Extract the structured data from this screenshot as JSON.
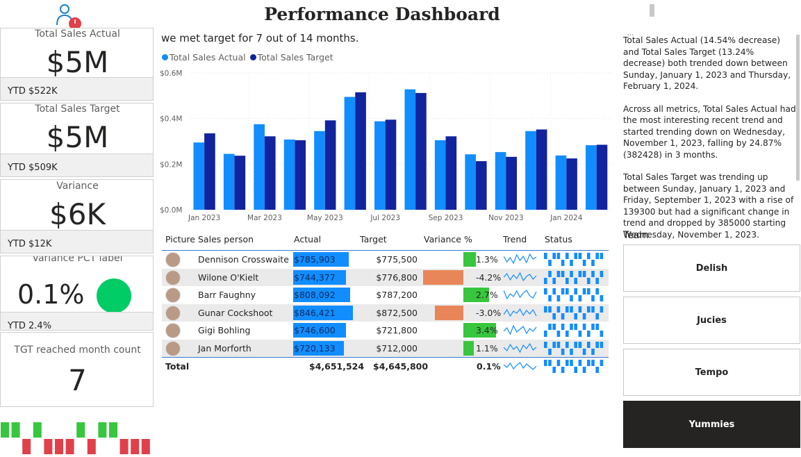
{
  "title": "Performance Dashboard",
  "kpis": {
    "sales_actual": {
      "title": "Total Sales Actual",
      "value": "$5M",
      "ytd": "YTD $522K"
    },
    "sales_target": {
      "title": "Total Sales Target",
      "value": "$5M",
      "ytd": "YTD $509K"
    },
    "variance": {
      "title": "Variance",
      "value": "$6K",
      "ytd": "YTD $12K"
    },
    "variance_pct": {
      "title": "Variance PCT label",
      "value": "0.1%",
      "ytd": "YTD 2.4%",
      "indicator_color": "#00cc66"
    },
    "tgt_reached": {
      "title": "TGT reached month count",
      "value": "7"
    }
  },
  "win_loss": [
    1,
    1,
    -1,
    1,
    -1,
    -1,
    -1,
    1,
    -1,
    1,
    1,
    -1,
    -1,
    -1
  ],
  "chart": {
    "subtitle": "we met target for 7 out of 14 months.",
    "legend": [
      "Total Sales Actual",
      "Total Sales Target"
    ]
  },
  "chart_data": {
    "type": "bar",
    "categories": [
      "Jan 2023",
      "Feb 2023",
      "Mar 2023",
      "Apr 2023",
      "May 2023",
      "Jun 2023",
      "Jul 2023",
      "Aug 2023",
      "Sep 2023",
      "Oct 2023",
      "Nov 2023",
      "Dec 2023",
      "Jan 2024",
      "Feb 2024"
    ],
    "x_tick_labels": [
      "Jan 2023",
      "Mar 2023",
      "May 2023",
      "Jul 2023",
      "Sep 2023",
      "Nov 2023",
      "Jan 2024"
    ],
    "series": [
      {
        "name": "Total Sales Actual",
        "color": "#118dff",
        "values": [
          0.295,
          0.245,
          0.375,
          0.308,
          0.345,
          0.495,
          0.388,
          0.528,
          0.305,
          0.243,
          0.253,
          0.345,
          0.238,
          0.283
        ]
      },
      {
        "name": "Total Sales Target",
        "color": "#12239e",
        "values": [
          0.335,
          0.237,
          0.322,
          0.305,
          0.392,
          0.515,
          0.395,
          0.512,
          0.322,
          0.213,
          0.232,
          0.352,
          0.225,
          0.285
        ]
      }
    ],
    "ylim": [
      0,
      0.6
    ],
    "y_ticks": [
      {
        "v": 0,
        "label": "$0.0M"
      },
      {
        "v": 0.2,
        "label": "$0.2M"
      },
      {
        "v": 0.4,
        "label": "$0.4M"
      },
      {
        "v": 0.6,
        "label": "$0.6M"
      }
    ],
    "grid": true,
    "legend_position": "top-left"
  },
  "table": {
    "headers": [
      "Picture",
      "Sales person",
      "Actual",
      "Target",
      "Variance %",
      "Trend",
      "Status"
    ],
    "max_actual": 846421,
    "rows": [
      {
        "name": "Dennison Crosswaite",
        "actual": "$785,903",
        "actual_num": 785903,
        "target": "$775,500",
        "variance": "1.3%",
        "variance_num": 1.3
      },
      {
        "name": "Wilone O'Kielt",
        "actual": "$744,377",
        "actual_num": 744377,
        "target": "$776,800",
        "variance": "-4.2%",
        "variance_num": -4.2
      },
      {
        "name": "Barr Faughny",
        "actual": "$808,092",
        "actual_num": 808092,
        "target": "$787,200",
        "variance": "2.7%",
        "variance_num": 2.7
      },
      {
        "name": "Gunar Cockshoot",
        "actual": "$846,421",
        "actual_num": 846421,
        "target": "$872,500",
        "variance": "-3.0%",
        "variance_num": -3.0
      },
      {
        "name": "Gigi Bohling",
        "actual": "$746,600",
        "actual_num": 746600,
        "target": "$721,800",
        "variance": "3.4%",
        "variance_num": 3.4
      },
      {
        "name": "Jan Morforth",
        "actual": "$720,133",
        "actual_num": 720133,
        "target": "$712,000",
        "variance": "1.1%",
        "variance_num": 1.1
      }
    ],
    "total": {
      "label": "Total",
      "actual": "$4,651,524",
      "target": "$4,645,800",
      "variance": "0.1%"
    }
  },
  "narrative": [
    "Total Sales Actual (14.54% decrease) and Total Sales Target (13.24% decrease) both trended down between Sunday, January 1, 2023 and Thursday, February 1, 2024.",
    "Across all metrics, Total Sales Actual had the most interesting recent trend and started trending down on Wednesday, November 1, 2023, falling by 24.87% (382428) in 3 months.",
    "Total Sales Target was trending up between Sunday, January 1, 2023 and Friday, September 1, 2023 with a rise of 139300 but had a significant change in trend and dropped by 385000 starting Wednesday, November 1, 2023."
  ],
  "team": {
    "title": "Team",
    "options": [
      "Delish",
      "Jucies",
      "Tempo",
      "Yummies"
    ],
    "selected": "Yummies"
  },
  "colors": {
    "actual": "#118dff",
    "target": "#12239e",
    "positive": "#37c63d",
    "negative": "#e8865a",
    "win": "#37c63d",
    "loss": "#e0404a"
  }
}
